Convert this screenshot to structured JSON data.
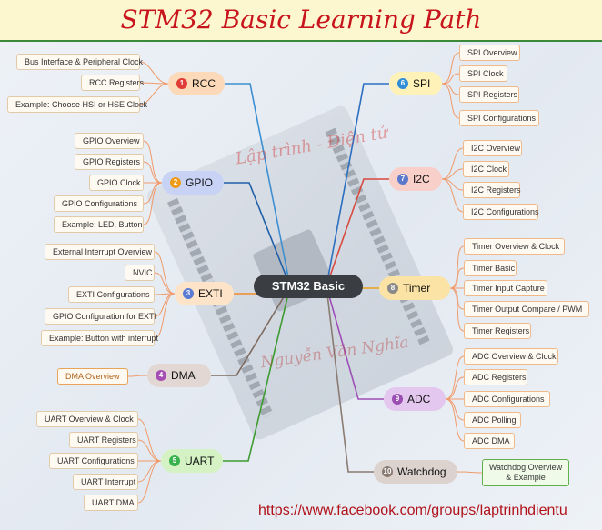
{
  "title": "STM32 Basic Learning Path",
  "center": "STM32 Basic",
  "watermarks": [
    "Lập trình - Điện tử",
    "Nguyễn Văn Nghĩa"
  ],
  "url": "https://www.facebook.com/groups/laptrinhdientu",
  "colors": {
    "title_text": "#c8141c",
    "title_bg": "#fdf7cf",
    "rcc": "#fcd9b8",
    "gpio": "#c7d2f5",
    "exti": "#fde3c8",
    "dma": "#e2d7d2",
    "uart": "#d4f2c3",
    "spi": "#fff2b8",
    "i2c": "#f9cfc9",
    "timer": "#fbe3a5",
    "adc": "#e3c7ee",
    "watchdog": "#ddd3ce"
  },
  "branches": [
    {
      "id": "rcc",
      "num": "1",
      "label": "RCC",
      "num_color": "#e03b36",
      "line": "#3d8fd1",
      "leaves": [
        "Bus Interface & Peripheral Clock",
        "RCC Registers",
        "Example: Choose HSI or HSE Clock"
      ]
    },
    {
      "id": "gpio",
      "num": "2",
      "label": "GPIO",
      "num_color": "#ef9b18",
      "line": "#1f5fa8",
      "leaves": [
        "GPIO Overview",
        "GPIO Registers",
        "GPIO Clock",
        "GPIO Configurations",
        "Example: LED, Button"
      ]
    },
    {
      "id": "exti",
      "num": "3",
      "label": "EXTI",
      "num_color": "#5a7bd4",
      "line": "#ef8b2b",
      "leaves": [
        "External Interrupt Overview",
        "NVIC",
        "EXTI Configurations",
        "GPIO Configuration for EXTI",
        "Example: Button with interrupt"
      ]
    },
    {
      "id": "dma",
      "num": "4",
      "label": "DMA",
      "num_color": "#a54fb4",
      "line": "#7e6a5e",
      "leaves": [
        "DMA Overview"
      ]
    },
    {
      "id": "uart",
      "num": "5",
      "label": "UART",
      "num_color": "#37b24d",
      "line": "#3d9b2f",
      "leaves": [
        "UART Overview & Clock",
        "UART Registers",
        "UART Configurations",
        "UART Interrupt",
        "UART DMA"
      ]
    },
    {
      "id": "spi",
      "num": "6",
      "label": "SPI",
      "num_color": "#2f8ed6",
      "line": "#2c6fbf",
      "leaves": [
        "SPI Overview",
        "SPI Clock",
        "SPI Registers",
        "SPI Configurations"
      ]
    },
    {
      "id": "i2c",
      "num": "7",
      "label": "I2C",
      "num_color": "#5a78cc",
      "line": "#d8493f",
      "leaves": [
        "I2C Overview",
        "I2C Clock",
        "I2C Registers",
        "I2C Configurations"
      ]
    },
    {
      "id": "timer",
      "num": "8",
      "label": "Timer",
      "num_color": "#8a8a8a",
      "line": "#e9a21d",
      "leaves": [
        "Timer Overview & Clock",
        "Timer Basic",
        "Timer Input Capture",
        "Timer Output Compare / PWM",
        "Timer Registers"
      ]
    },
    {
      "id": "adc",
      "num": "9",
      "label": "ADC",
      "num_color": "#9b4fb3",
      "line": "#9d4fb6",
      "leaves": [
        "ADC Overview & Clock",
        "ADC Registers",
        "ADC Configurations",
        "ADC Polling",
        "ADC DMA"
      ]
    },
    {
      "id": "watchdog",
      "num": "10",
      "label": "Watchdog",
      "num_color": "#8a7b72",
      "line": "#8a7b72",
      "leaves": [
        "Watchdog Overview & Example"
      ]
    }
  ]
}
